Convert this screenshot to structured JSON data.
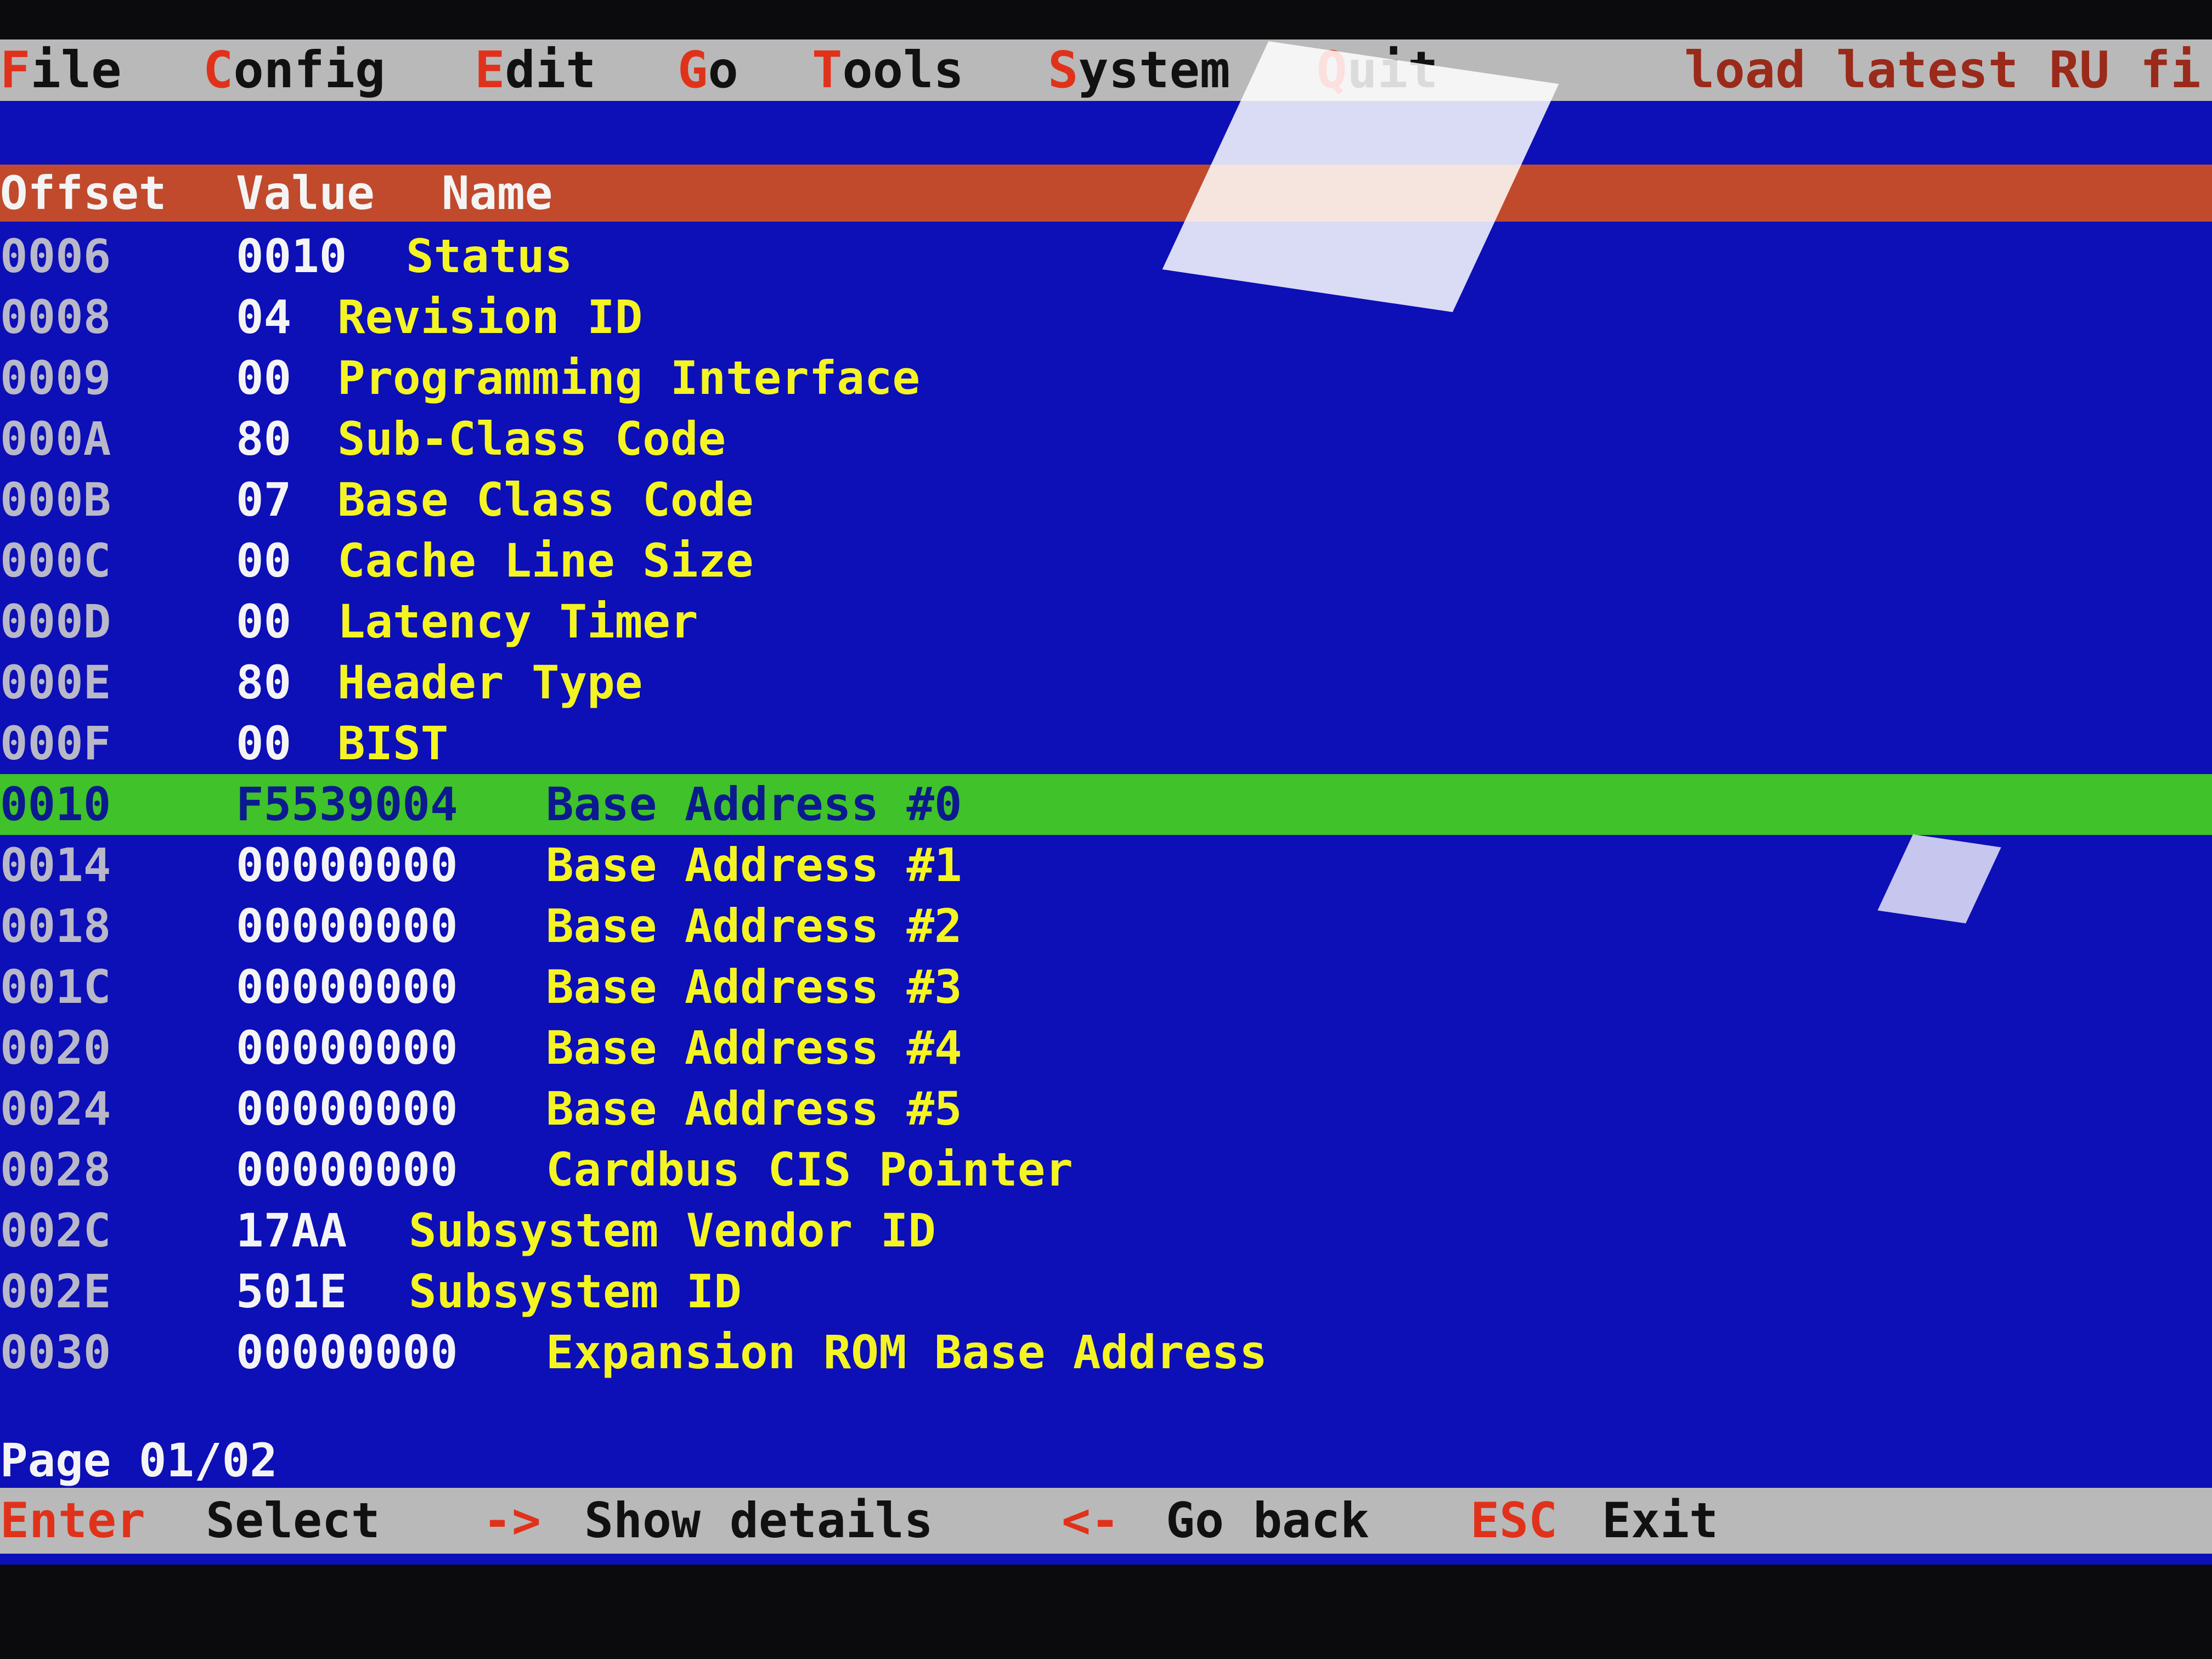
{
  "menubar": {
    "items": [
      {
        "hot": "F",
        "rest": "ile"
      },
      {
        "hot": "C",
        "rest": "onfig"
      },
      {
        "hot": "E",
        "rest": "dit"
      },
      {
        "hot": "G",
        "rest": "o"
      },
      {
        "hot": "T",
        "rest": "ools"
      },
      {
        "hot": "S",
        "rest": "ystem"
      },
      {
        "hot": "Q",
        "rest": "uit"
      }
    ],
    "right_text": "load latest RU fi"
  },
  "table": {
    "headers": {
      "offset": "Offset",
      "value": "Value",
      "name": "Name"
    },
    "rows": [
      {
        "offset": "0006",
        "value": "0010",
        "name": "Status"
      },
      {
        "offset": "0008",
        "value": "04",
        "name": "Revision ID"
      },
      {
        "offset": "0009",
        "value": "00",
        "name": "Programming Interface"
      },
      {
        "offset": "000A",
        "value": "80",
        "name": "Sub-Class Code"
      },
      {
        "offset": "000B",
        "value": "07",
        "name": "Base Class Code"
      },
      {
        "offset": "000C",
        "value": "00",
        "name": "Cache Line Size"
      },
      {
        "offset": "000D",
        "value": "00",
        "name": "Latency Timer"
      },
      {
        "offset": "000E",
        "value": "80",
        "name": "Header Type"
      },
      {
        "offset": "000F",
        "value": "00",
        "name": "BIST"
      },
      {
        "offset": "0010",
        "value": "F5539004",
        "name": "Base Address #0"
      },
      {
        "offset": "0014",
        "value": "00000000",
        "name": "Base Address #1"
      },
      {
        "offset": "0018",
        "value": "00000000",
        "name": "Base Address #2"
      },
      {
        "offset": "001C",
        "value": "00000000",
        "name": "Base Address #3"
      },
      {
        "offset": "0020",
        "value": "00000000",
        "name": "Base Address #4"
      },
      {
        "offset": "0024",
        "value": "00000000",
        "name": "Base Address #5"
      },
      {
        "offset": "0028",
        "value": "00000000",
        "name": "Cardbus CIS Pointer"
      },
      {
        "offset": "002C",
        "value": "17AA",
        "name": "Subsystem Vendor ID"
      },
      {
        "offset": "002E",
        "value": "501E",
        "name": "Subsystem ID"
      },
      {
        "offset": "0030",
        "value": "00000000",
        "name": "Expansion ROM Base Address"
      }
    ],
    "selected_offset": "0010"
  },
  "page_indicator": "Page 01/02",
  "statusbar": {
    "items": [
      {
        "key": "Enter",
        "action": "Select"
      },
      {
        "key": "->",
        "action": "Show details"
      },
      {
        "key": "<-",
        "action": "Go back"
      },
      {
        "key": "ESC",
        "action": "Exit"
      }
    ]
  },
  "colors": {
    "screen_bg": "#0d0fb7",
    "bar_bg": "#b9b9b9",
    "hotkey": "#e0321b",
    "header_bg": "#c14a2c",
    "selected_bg": "#3fc22a",
    "name_text": "#f4f422",
    "value_text": "#f4f4f4"
  }
}
